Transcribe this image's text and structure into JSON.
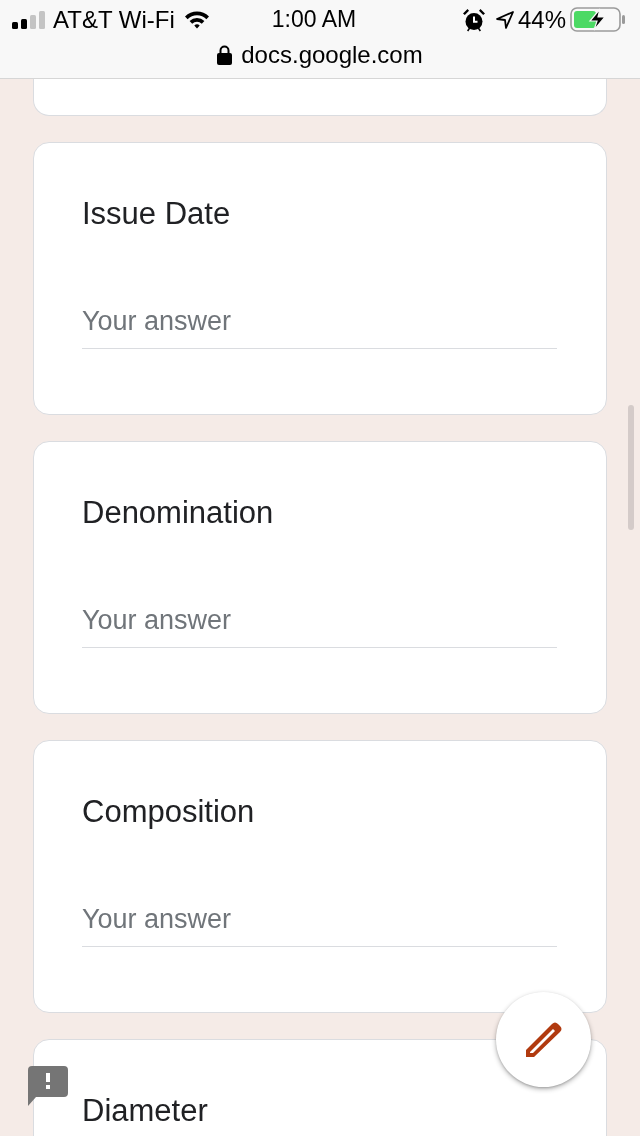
{
  "status_bar": {
    "carrier": "AT&T Wi-Fi",
    "time": "1:00 AM",
    "battery": "44%",
    "charging": true,
    "url": "docs.google.com"
  },
  "questions": [
    {
      "title": "Issue Date",
      "placeholder": "Your answer"
    },
    {
      "title": "Denomination",
      "placeholder": "Your answer"
    },
    {
      "title": "Composition",
      "placeholder": "Your answer"
    },
    {
      "title": "Diameter"
    }
  ]
}
